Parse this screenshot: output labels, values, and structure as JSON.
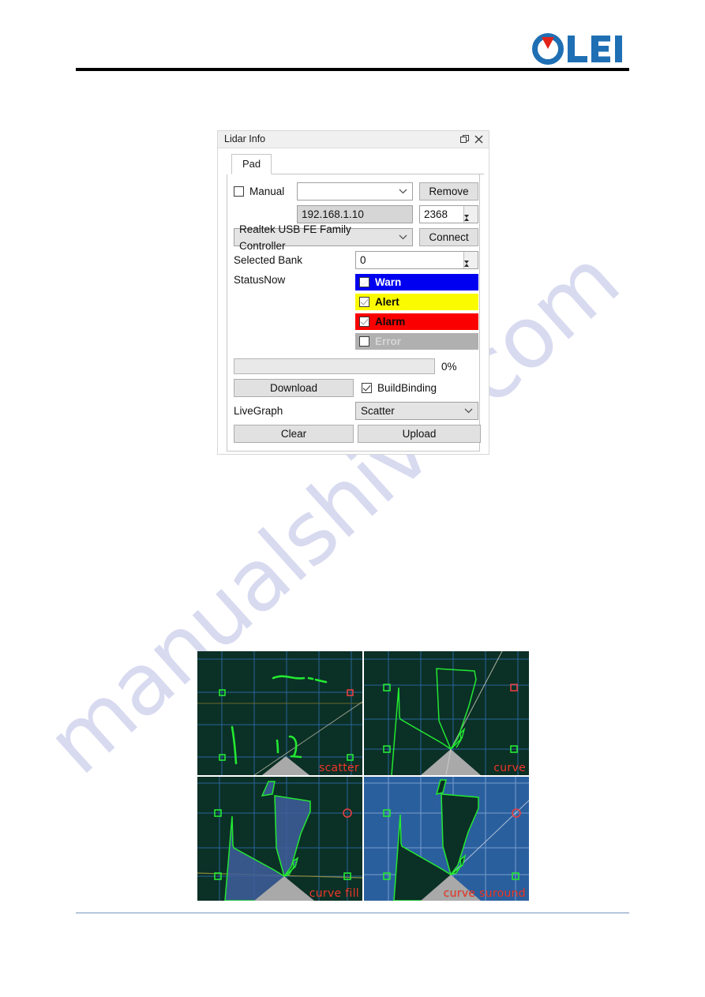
{
  "header": {
    "logo_text": "OLEI",
    "logo_colors": {
      "blue": "#1f6fb4",
      "red": "#e2231a"
    },
    "rule_color": "#000000"
  },
  "footer": {
    "rule_color": "#7596b8"
  },
  "watermark": {
    "text": "manualshive.com",
    "color": "#b9bde4"
  },
  "dialog": {
    "title": "Lidar Info",
    "titlebar_buttons": [
      {
        "name": "float-icon",
        "label": "Float"
      },
      {
        "name": "close-icon",
        "label": "Close"
      }
    ],
    "tabs": [
      {
        "label": "Pad",
        "active": true
      }
    ],
    "manual": {
      "checkbox_label": "Manual",
      "checked": false,
      "device_combo_value": "",
      "device_combo_placeholder": "",
      "remove_button": "Remove"
    },
    "address": {
      "ip_value": "192.168.1.10",
      "port_value": "2368"
    },
    "adapter": {
      "combo_value": "Realtek USB FE Family Controller",
      "connect_button": "Connect"
    },
    "selected_bank": {
      "label": "Selected Bank",
      "value": "0"
    },
    "status_now": {
      "label": "StatusNow",
      "items": [
        {
          "label": "Warn",
          "checked": true,
          "bg": "#0000f0",
          "fg": "#ffffff",
          "check_style": "light",
          "enabled": true
        },
        {
          "label": "Alert",
          "checked": true,
          "bg": "#fbfb00",
          "fg": "#0a0a0a",
          "check_style": "gray",
          "enabled": true
        },
        {
          "label": "Alarm",
          "checked": true,
          "bg": "#fb0000",
          "fg": "#0a0a0a",
          "check_style": "gray",
          "enabled": true
        },
        {
          "label": "Error",
          "checked": false,
          "bg": "#b0b0b0",
          "fg": "#d6d6d6",
          "check_style": "gray",
          "enabled": false
        }
      ]
    },
    "progress": {
      "value": 0,
      "percent_label": "0%"
    },
    "download_row": {
      "download_button": "Download",
      "buildbinding_label": "BuildBinding",
      "buildbinding_checked": true
    },
    "livegraph": {
      "label": "LiveGraph",
      "combo_value": "Scatter",
      "options": [
        "Scatter",
        "curve",
        "curve fill",
        "curve suround"
      ]
    },
    "bottom_buttons": {
      "clear_button": "Clear",
      "upload_button": "Upload"
    }
  },
  "view_grid": {
    "cells": [
      {
        "name": "scatter-view",
        "caption": "scatter",
        "mode": "scatter",
        "bg": "#0b3026",
        "grid": "#4f86c6",
        "accent": "#23e832"
      },
      {
        "name": "curve-view",
        "caption": "curve",
        "mode": "curve",
        "bg": "#0b3026",
        "grid": "#4f86c6",
        "accent": "#23e832"
      },
      {
        "name": "curve-fill-view",
        "caption": "curve fill",
        "mode": "fill",
        "bg": "#0b3026",
        "grid": "#4f86c6",
        "accent": "#23e832"
      },
      {
        "name": "curve-suround-view",
        "caption": "curve suround",
        "mode": "surround",
        "bg": "#2a5f9e",
        "grid": "#8fb4dd",
        "accent": "#23e832"
      }
    ],
    "caption_color": "#f03a2a"
  }
}
